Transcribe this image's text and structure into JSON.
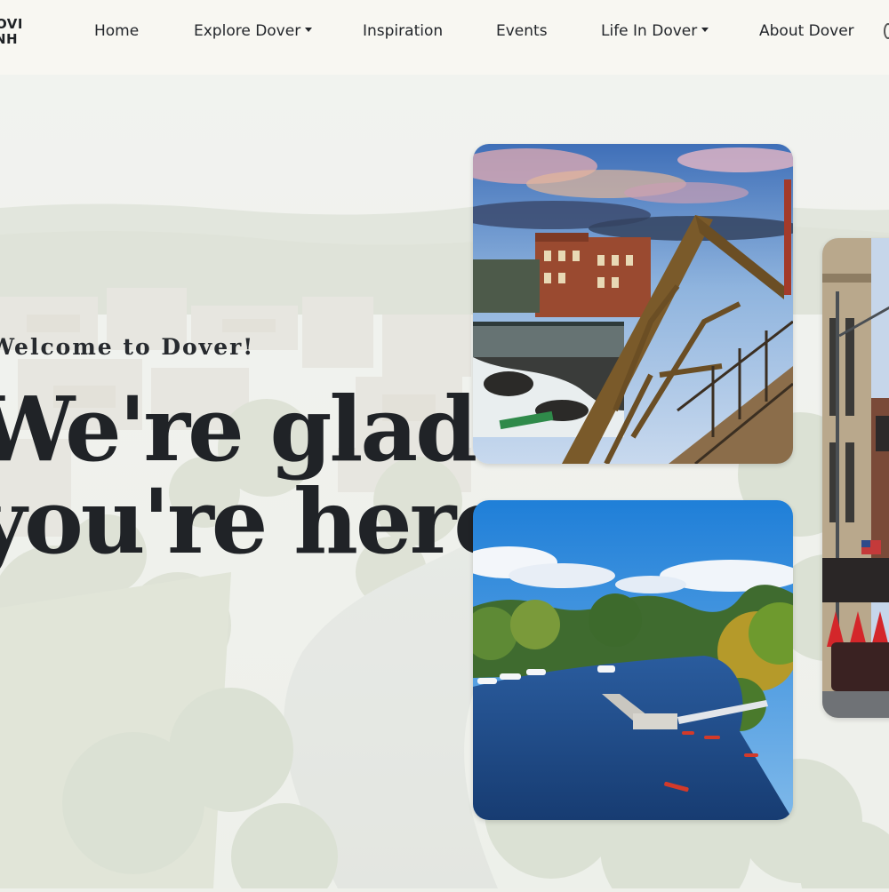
{
  "nav": {
    "logo_line1": "DOVER",
    "logo_line2": "NH",
    "items": [
      {
        "label": "Home",
        "dropdown": false
      },
      {
        "label": "Explore Dover",
        "dropdown": true
      },
      {
        "label": "Inspiration",
        "dropdown": false
      },
      {
        "label": "Events",
        "dropdown": false
      },
      {
        "label": "Life In Dover",
        "dropdown": true
      },
      {
        "label": "About Dover",
        "dropdown": false
      }
    ]
  },
  "hero": {
    "welcome": "Welcome to Dover!",
    "headline_line1": "We're glad",
    "headline_line2": "you're here."
  },
  "photos": [
    {
      "subject": "bridge-over-falls"
    },
    {
      "subject": "river-with-kayaks"
    },
    {
      "subject": "downtown-street"
    }
  ],
  "colors": {
    "nav_bg": "#f8f7f2",
    "text": "#202327"
  }
}
